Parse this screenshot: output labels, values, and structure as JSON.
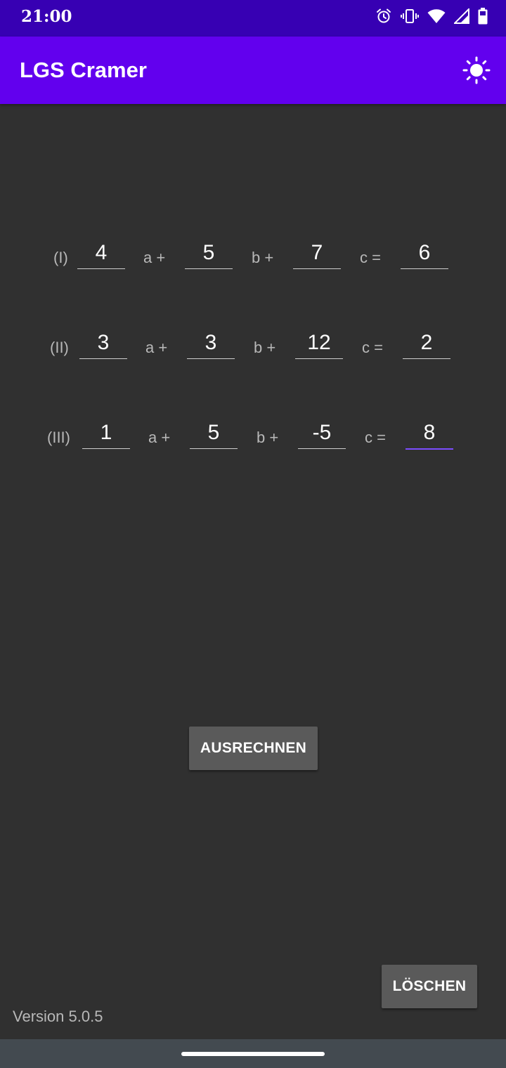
{
  "status_bar": {
    "time": "21:00",
    "icons": [
      "alarm-icon",
      "vibrate-icon",
      "wifi-icon",
      "signal-icon",
      "battery-icon"
    ]
  },
  "app_bar": {
    "title": "LGS Cramer",
    "action_icon": "brightness-icon"
  },
  "equations": [
    {
      "label": "(I)",
      "coefficients": [
        "4",
        "5",
        "7"
      ],
      "result": "6",
      "ops": [
        "a +",
        "b +",
        "c ="
      ]
    },
    {
      "label": "(II)",
      "coefficients": [
        "3",
        "3",
        "12"
      ],
      "result": "2",
      "ops": [
        "a +",
        "b +",
        "c ="
      ]
    },
    {
      "label": "(III)",
      "coefficients": [
        "1",
        "5",
        "-5"
      ],
      "result": "8",
      "ops": [
        "a +",
        "b +",
        "c ="
      ]
    }
  ],
  "buttons": {
    "calculate": "AUSRECHNEN",
    "clear": "LÖSCHEN"
  },
  "footer": {
    "version": "Version 5.0.5"
  },
  "colors": {
    "status_bar": "#3700b3",
    "app_bar": "#6200ee",
    "background": "#303030",
    "accent": "#7c4dff"
  }
}
